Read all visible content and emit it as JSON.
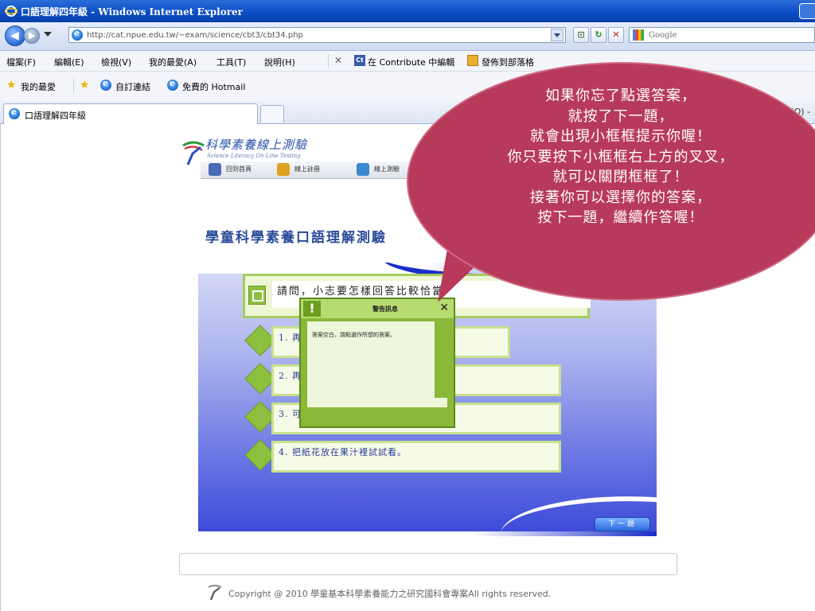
{
  "window": {
    "title": "口語理解四年級 - Windows Internet Explorer"
  },
  "address_bar": {
    "url": "http://cat.npue.edu.tw/~exam/science/cbt3/cbt34.php",
    "search_placeholder": "Google"
  },
  "menu": {
    "items": [
      "檔案(F)",
      "編輯(E)",
      "檢視(V)",
      "我的最愛(A)",
      "工具(T)",
      "說明(H)"
    ],
    "contribute": "在 Contribute 中編輯",
    "contribute_icon_text": "Ct",
    "publish": "發佈到部落格"
  },
  "favorites_bar": {
    "favorites": "我的最愛",
    "links": [
      "自訂連結",
      "免費的 Hotmail"
    ]
  },
  "tabs": {
    "active": "口語理解四年級",
    "edge_text": "(O) -"
  },
  "site": {
    "title": "科學素養線上測驗",
    "subtitle": "Science Literacy On-Line Testing",
    "nav": [
      "回到首頁",
      "線上註冊",
      "線上測驗"
    ]
  },
  "page": {
    "heading": "學童科學素養口語理解測驗"
  },
  "quiz": {
    "question": "請問，小志要怎樣回答比較恰當",
    "options": [
      "1. 再",
      "2. 再",
      "3. 可",
      "4. 把紙花放在果汁裡試試看。"
    ],
    "next_label": "下一題"
  },
  "warning": {
    "title": "警告訊息",
    "close": "✕",
    "icon_text": "!",
    "message": "答案空白，請點選作所想的答案。"
  },
  "annotation": {
    "lines": [
      "如果你忘了點選答案，",
      "就按了下一題，",
      "就會出現小框框提示你喔！",
      "你只要按下小框框右上方的叉叉，",
      "就可以關閉框框了！",
      "接著你可以選擇你的答案，",
      "按下一題，繼續作答喔！"
    ]
  },
  "footer": {
    "copyright": "Copyright @ 2010 學童基本科學素養能力之研究國科會專案All rights reserved."
  },
  "colors": {
    "bubble": "#b83a5a",
    "dialog_green": "#8ab838",
    "panel_blue": "#3a48d8"
  }
}
